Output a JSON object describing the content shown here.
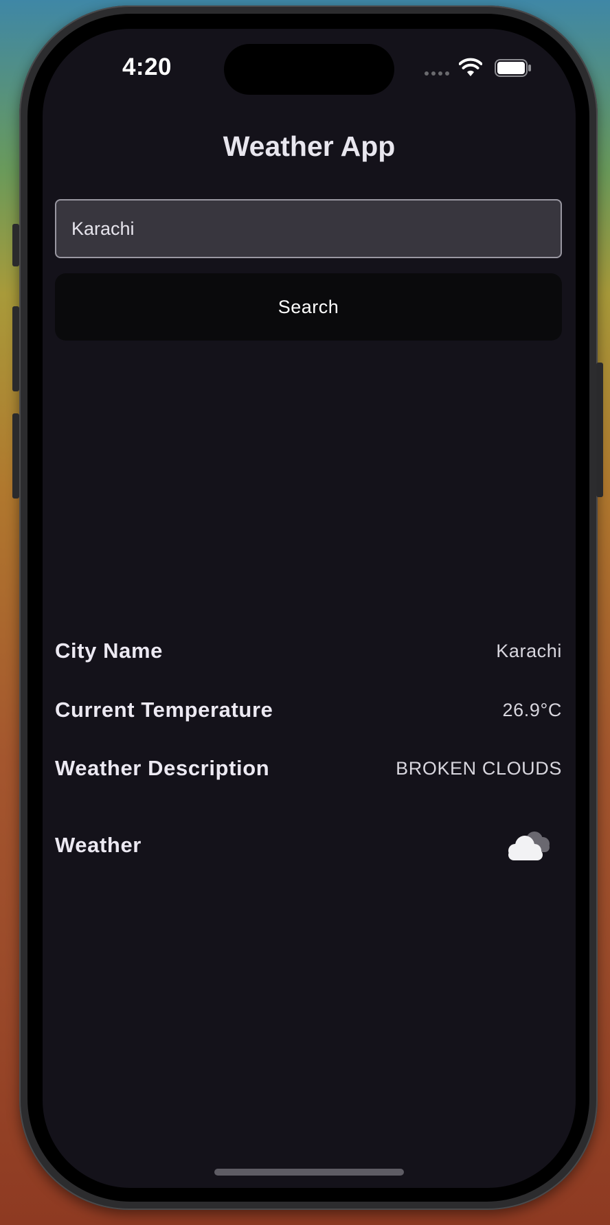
{
  "status_bar": {
    "time": "4:20"
  },
  "app": {
    "title": "Weather App"
  },
  "search": {
    "value": "Karachi",
    "button_label": "Search"
  },
  "details": [
    {
      "label": "City Name",
      "value": "Karachi"
    },
    {
      "label": "Current Temperature",
      "value": "26.9°C"
    },
    {
      "label": "Weather Description",
      "value": "BROKEN CLOUDS"
    },
    {
      "label": "Weather",
      "icon": "broken-clouds-icon"
    }
  ],
  "colors": {
    "screen_background": "#14121a",
    "input_background": "#38363e",
    "button_background": "#0a0a0c",
    "text_primary": "#ece9f2"
  }
}
